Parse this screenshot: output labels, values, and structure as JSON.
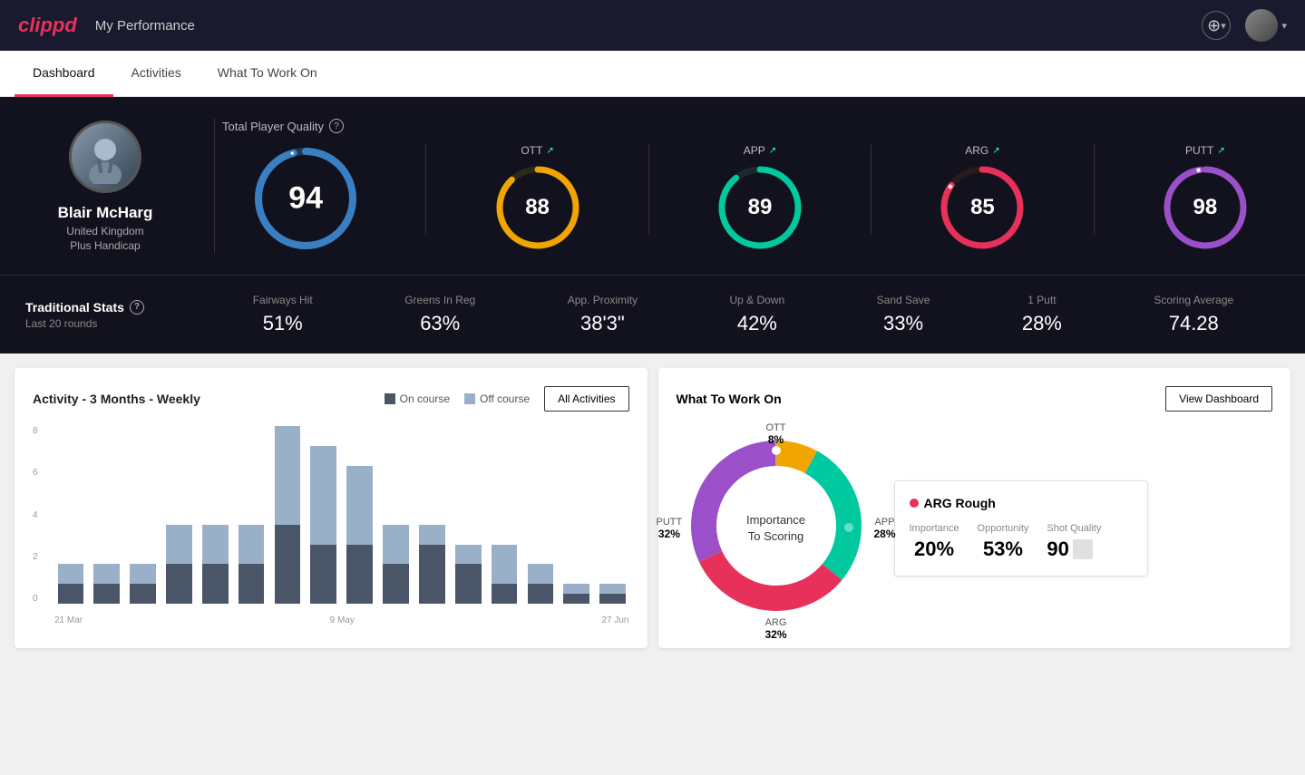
{
  "app": {
    "logo": "clippd",
    "header_title": "My Performance",
    "add_icon": "⊕",
    "dropdown_arrow": "▾"
  },
  "nav": {
    "tabs": [
      {
        "id": "dashboard",
        "label": "Dashboard",
        "active": true
      },
      {
        "id": "activities",
        "label": "Activities",
        "active": false
      },
      {
        "id": "what-to-work-on",
        "label": "What To Work On",
        "active": false
      }
    ]
  },
  "player": {
    "name": "Blair McHarg",
    "country": "United Kingdom",
    "handicap": "Plus Handicap"
  },
  "total_quality": {
    "label": "Total Player Quality",
    "main_score": 94,
    "categories": [
      {
        "id": "ott",
        "label": "OTT",
        "score": 88,
        "color": "#f0a500",
        "track_color": "#3a3a2e",
        "pct": 88
      },
      {
        "id": "app",
        "label": "APP",
        "score": 89,
        "color": "#00c9a0",
        "track_color": "#1a3a2e",
        "pct": 89
      },
      {
        "id": "arg",
        "label": "ARG",
        "score": 85,
        "color": "#e8315a",
        "track_color": "#2a1a1e",
        "pct": 85
      },
      {
        "id": "putt",
        "label": "PUTT",
        "score": 98,
        "color": "#9b4fc8",
        "track_color": "#2a1a3a",
        "pct": 98
      }
    ]
  },
  "traditional_stats": {
    "label": "Traditional Stats",
    "sublabel": "Last 20 rounds",
    "stats": [
      {
        "id": "fairways-hit",
        "label": "Fairways Hit",
        "value": "51%"
      },
      {
        "id": "greens-in-reg",
        "label": "Greens In Reg",
        "value": "63%"
      },
      {
        "id": "app-proximity",
        "label": "App. Proximity",
        "value": "38'3\""
      },
      {
        "id": "up-and-down",
        "label": "Up & Down",
        "value": "42%"
      },
      {
        "id": "sand-save",
        "label": "Sand Save",
        "value": "33%"
      },
      {
        "id": "one-putt",
        "label": "1 Putt",
        "value": "28%"
      },
      {
        "id": "scoring-average",
        "label": "Scoring Average",
        "value": "74.28"
      }
    ]
  },
  "activity_chart": {
    "title": "Activity - 3 Months - Weekly",
    "legend": [
      {
        "label": "On course",
        "color": "#4a5568"
      },
      {
        "label": "Off course",
        "color": "#9ab0c8"
      }
    ],
    "all_activities_label": "All Activities",
    "y_labels": [
      "8",
      "6",
      "4",
      "2",
      "0"
    ],
    "x_labels": [
      "21 Mar",
      "9 May",
      "27 Jun"
    ],
    "bars": [
      {
        "on": 1,
        "off": 1
      },
      {
        "on": 1,
        "off": 1
      },
      {
        "on": 1,
        "off": 1
      },
      {
        "on": 2,
        "off": 2
      },
      {
        "on": 2,
        "off": 2
      },
      {
        "on": 2,
        "off": 2
      },
      {
        "on": 4,
        "off": 5
      },
      {
        "on": 3,
        "off": 5
      },
      {
        "on": 3,
        "off": 4
      },
      {
        "on": 2,
        "off": 2
      },
      {
        "on": 3,
        "off": 1
      },
      {
        "on": 2,
        "off": 1
      },
      {
        "on": 1,
        "off": 2
      },
      {
        "on": 1,
        "off": 1
      },
      {
        "on": 0.5,
        "off": 0.5
      },
      {
        "on": 0.5,
        "off": 0.5
      }
    ]
  },
  "what_to_work_on": {
    "title": "What To Work On",
    "view_dashboard_label": "View Dashboard",
    "donut_center": "Importance\nTo Scoring",
    "segments": [
      {
        "label": "OTT",
        "pct": 8,
        "color": "#f0a500"
      },
      {
        "label": "APP",
        "pct": 28,
        "color": "#00c9a0"
      },
      {
        "label": "ARG",
        "pct": 32,
        "color": "#e8315a"
      },
      {
        "label": "PUTT",
        "pct": 32,
        "color": "#9b4fc8"
      }
    ],
    "info_card": {
      "title": "ARG Rough",
      "dot_color": "#e8315a",
      "columns": [
        {
          "label": "Importance",
          "value": "20%"
        },
        {
          "label": "Opportunity",
          "value": "53%"
        },
        {
          "label": "Shot Quality",
          "value": "90",
          "has_badge": true
        }
      ]
    }
  }
}
